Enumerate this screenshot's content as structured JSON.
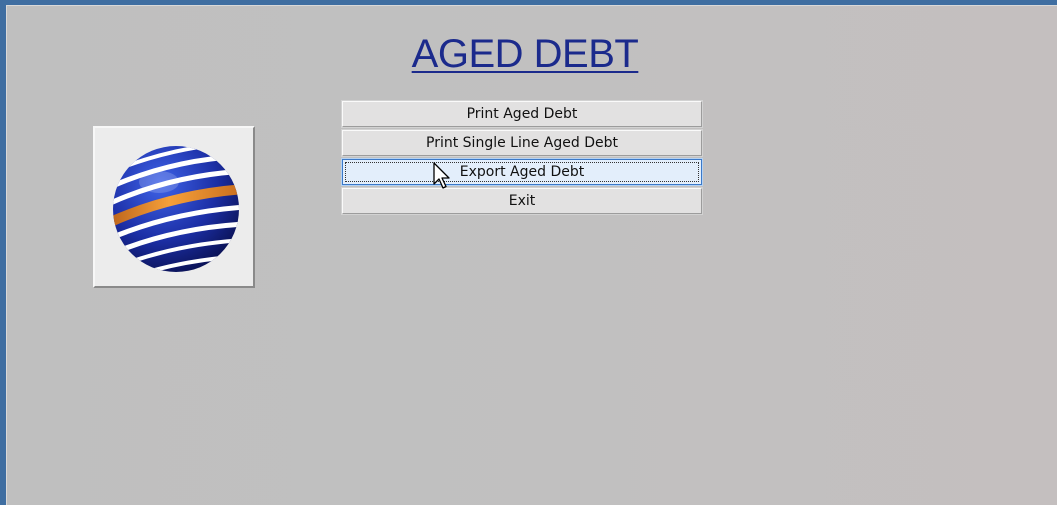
{
  "window": {
    "title": "AGED DEBT"
  },
  "logo": {
    "icon": "striped-globe-icon",
    "colors": {
      "blue": "#1e2fa8",
      "stripe": "#ffffff",
      "accent": "#f0922b"
    }
  },
  "menu": {
    "items": [
      {
        "label": "Print Aged Debt",
        "focused": false
      },
      {
        "label": "Print Single Line Aged Debt",
        "focused": false
      },
      {
        "label": "Export Aged Debt",
        "focused": true
      },
      {
        "label": "Exit",
        "focused": false
      }
    ]
  },
  "cursor": {
    "icon": "arrow-cursor-icon"
  },
  "colors": {
    "title": "#1b2a8c",
    "background": "#c0c0c0",
    "focus_border": "#3b79c9"
  }
}
